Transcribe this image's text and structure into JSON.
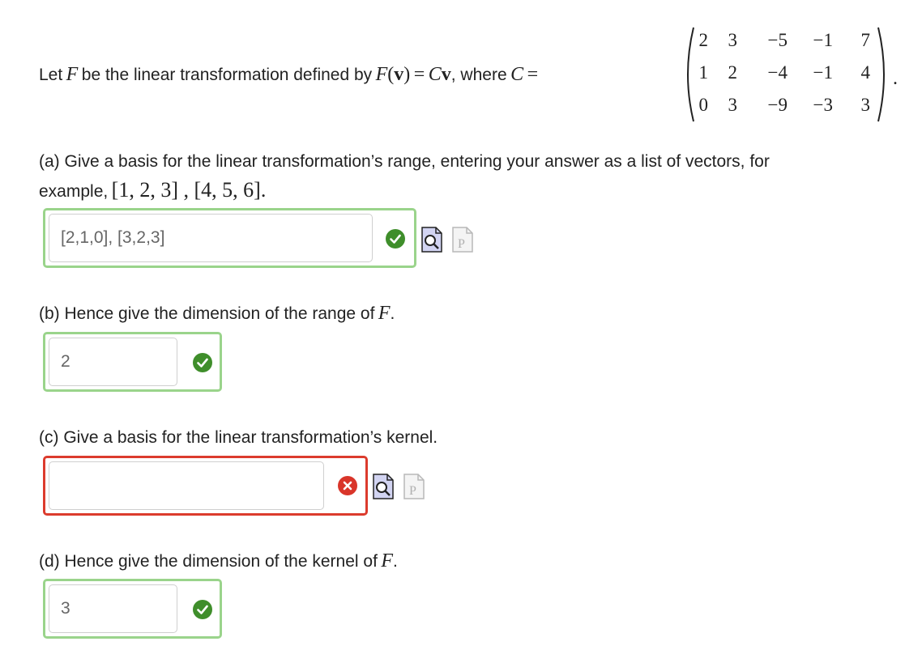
{
  "intro": {
    "prefix": "Let",
    "F": "F",
    "be_text": "be the linear transformation defined by",
    "fv_F": "F",
    "fv_open": "(",
    "fv_v": "v",
    "fv_close": ")",
    "eq": "=",
    "Cv_C": "C",
    "Cv_v": "v",
    "comma_where": ", where",
    "C": "C",
    "eq2": "=",
    "period": "."
  },
  "matrix": {
    "rows": [
      [
        "2",
        "3",
        "−5",
        "−1",
        "7"
      ],
      [
        "1",
        "2",
        "−4",
        "−1",
        "4"
      ],
      [
        "0",
        "3",
        "−9",
        "−3",
        "3"
      ]
    ]
  },
  "part_a": {
    "text": "(a) Give a basis for the linear transformation’s range, entering your answer as a list of vectors, for",
    "text2": "example,",
    "example": "[1, 2, 3] , [4, 5, 6]",
    "example_period": ".",
    "answer": "[2,1,0], [3,2,3]",
    "status": "correct"
  },
  "part_b": {
    "text": "(b) Hence give the dimension of the range of",
    "F": "F",
    "period": ".",
    "answer": "2",
    "status": "correct"
  },
  "part_c": {
    "text": "(c) Give a basis for the linear transformation’s kernel.",
    "answer": "",
    "status": "incorrect"
  },
  "part_d": {
    "text": "(d) Hence give the dimension of the kernel of",
    "F": "F",
    "period": ".",
    "answer": "3",
    "status": "correct"
  },
  "icons": {
    "correct": "check-circle-icon",
    "incorrect": "x-circle-icon",
    "preview": "preview-document-icon",
    "pdf": "pdf-document-icon"
  },
  "colors": {
    "correct_border": "#9ad48b",
    "incorrect_border": "#dc3b2d",
    "check_green": "#3f8e2b",
    "cross_red": "#d9352a"
  }
}
